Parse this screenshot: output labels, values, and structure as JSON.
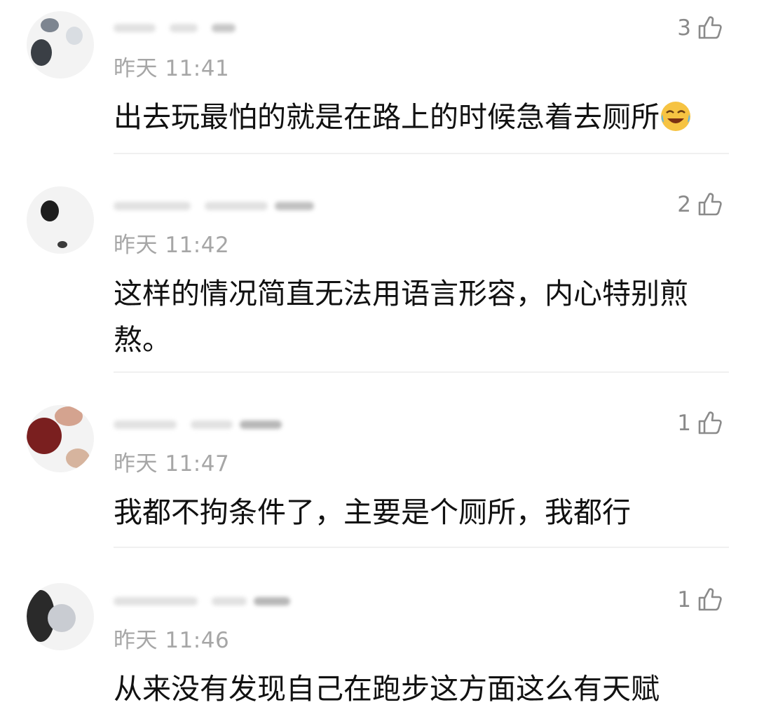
{
  "comments": [
    {
      "time": "昨天 11:41",
      "likes": "3",
      "text": "出去玩最怕的就是在路上的时候急着去厕所",
      "emoji": "crying-laughing-emoji"
    },
    {
      "time": "昨天 11:42",
      "likes": "2",
      "text": "这样的情况简直无法用语言形容，内心特别煎熬。"
    },
    {
      "time": "昨天 11:47",
      "likes": "1",
      "text": "我都不拘条件了，主要是个厕所，我都行"
    },
    {
      "time": "昨天 11:46",
      "likes": "1",
      "text": "从来没有发现自己在跑步这方面这么有天赋"
    }
  ],
  "icons": {
    "like": "thumbs-up-icon"
  }
}
